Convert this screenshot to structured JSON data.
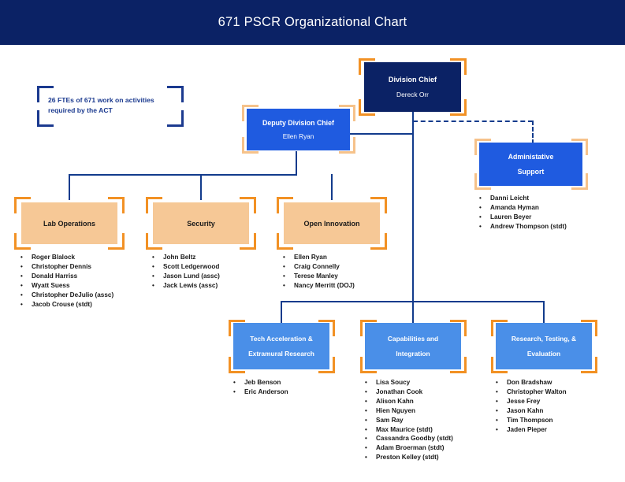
{
  "header": {
    "title": "671 PSCR Organizational Chart",
    "bg_color": "#0B2265",
    "text_color": "#FFFFFF"
  },
  "callout": {
    "text_line1": "26 FTEs of 671 work on activities",
    "text_line2": "required by the ACT",
    "bracket_color": "#1B3A8F"
  },
  "palette": {
    "navy": "#0B2265",
    "blue": "#1F5BE0",
    "light_blue": "#4A8FE8",
    "peach": "#F6C896",
    "orange_bracket": "#F29124",
    "tan_bracket": "#F6C28A",
    "line_navy": "#123B8C"
  },
  "nodes": {
    "division_chief": {
      "title": "Division Chief",
      "name": "Dereck Orr",
      "members": []
    },
    "deputy_division_chief": {
      "title": "Deputy Division Chief",
      "name": "Ellen Ryan",
      "members": []
    },
    "administrative_support": {
      "title_line1": "Administative",
      "title_line2": "Support",
      "members": [
        "Danni Leicht",
        "Amanda Hyman",
        "Lauren Beyer",
        "Andrew Thompson (stdt)"
      ]
    },
    "lab_operations": {
      "title": "Lab Operations",
      "members": [
        "Roger Blalock",
        "Christopher Dennis",
        "Donald Harriss",
        "Wyatt Suess",
        "Christopher DeJulio (assc)",
        "Jacob Crouse (stdt)"
      ]
    },
    "security": {
      "title": "Security",
      "members": [
        "John Beltz",
        "Scott Ledgerwood",
        "Jason Lund (assc)",
        "Jack Lewis (assc)"
      ]
    },
    "open_innovation": {
      "title": "Open Innovation",
      "members": [
        "Ellen Ryan",
        "Craig Connelly",
        "Terese Manley",
        "Nancy Merritt (DOJ)"
      ]
    },
    "tech_acceleration": {
      "title_line1": "Tech Acceleration &",
      "title_line2": "Extramural Research",
      "members": [
        "Jeb Benson",
        "Eric Anderson"
      ]
    },
    "capabilities_integration": {
      "title_line1": "Capabilities and",
      "title_line2": "Integration",
      "members": [
        "Lisa Soucy",
        "Jonathan Cook",
        "Alison Kahn",
        "Hien Nguyen",
        "Sam Ray",
        "Max Maurice (stdt)",
        "Cassandra Goodby (stdt)",
        "Adam Broerman (stdt)",
        "Preston Kelley (stdt)"
      ]
    },
    "research_testing_evaluation": {
      "title_line1": "Research, Testing, &",
      "title_line2": "Evaluation",
      "members": [
        "Don Bradshaw",
        "Christopher Walton",
        "Jesse Frey",
        "Jason Kahn",
        "Tim Thompson",
        "Jaden Pieper"
      ]
    }
  },
  "bullet_glyph": "•"
}
